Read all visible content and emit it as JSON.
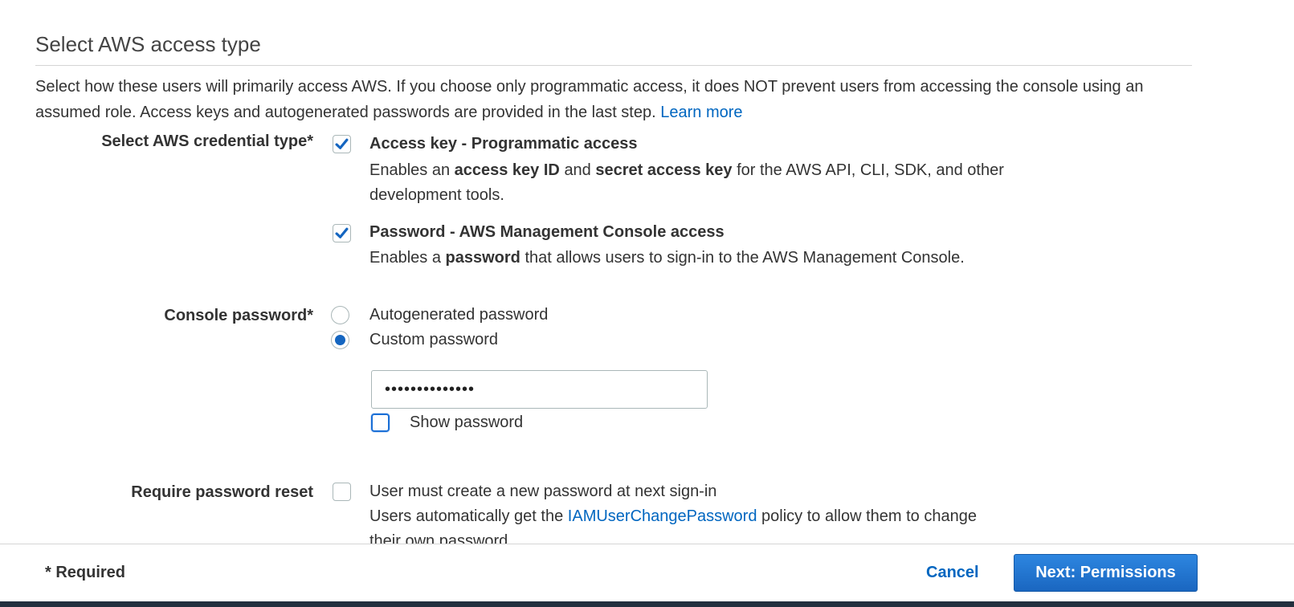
{
  "section": {
    "title": "Select AWS access type",
    "description": "Select how these users will primarily access AWS. If you choose only programmatic access, it does NOT prevent users from accessing the console using an assumed role. Access keys and autogenerated passwords are provided in the last step.",
    "learn_more": "Learn more"
  },
  "credential_type": {
    "label": "Select AWS credential type*",
    "access_key": {
      "checked": true,
      "title": "Access key - Programmatic access",
      "desc_1": "Enables an",
      "desc_bold_1": "access key ID",
      "desc_2": "and",
      "desc_bold_2": "secret access key",
      "desc_3": "for the AWS API, CLI, SDK, and other development tools."
    },
    "console_access": {
      "checked": true,
      "title": "Password - AWS Management Console access",
      "desc_1": "Enables a",
      "desc_bold_1": "password",
      "desc_2": "that allows users to sign-in to the AWS Management Console."
    }
  },
  "console_password": {
    "label": "Console password*",
    "options": [
      {
        "label": "Autogenerated password",
        "selected": false
      },
      {
        "label": "Custom password",
        "selected": true
      }
    ],
    "value": "••••••••••••••",
    "show_password_label": "Show password"
  },
  "password_reset": {
    "label": "Require password reset",
    "title": "User must create a new password at next sign-in",
    "desc_1": "Users automatically get the",
    "policy_link": "IAMUserChangePassword",
    "desc_2": "policy to allow them to change their own password."
  },
  "footer": {
    "required": "* Required",
    "cancel": "Cancel",
    "next": "Next: Permissions"
  },
  "colors": {
    "link": "#0066c0",
    "primary_button": "#1a66c0",
    "checkbox_check": "#1465c0"
  }
}
